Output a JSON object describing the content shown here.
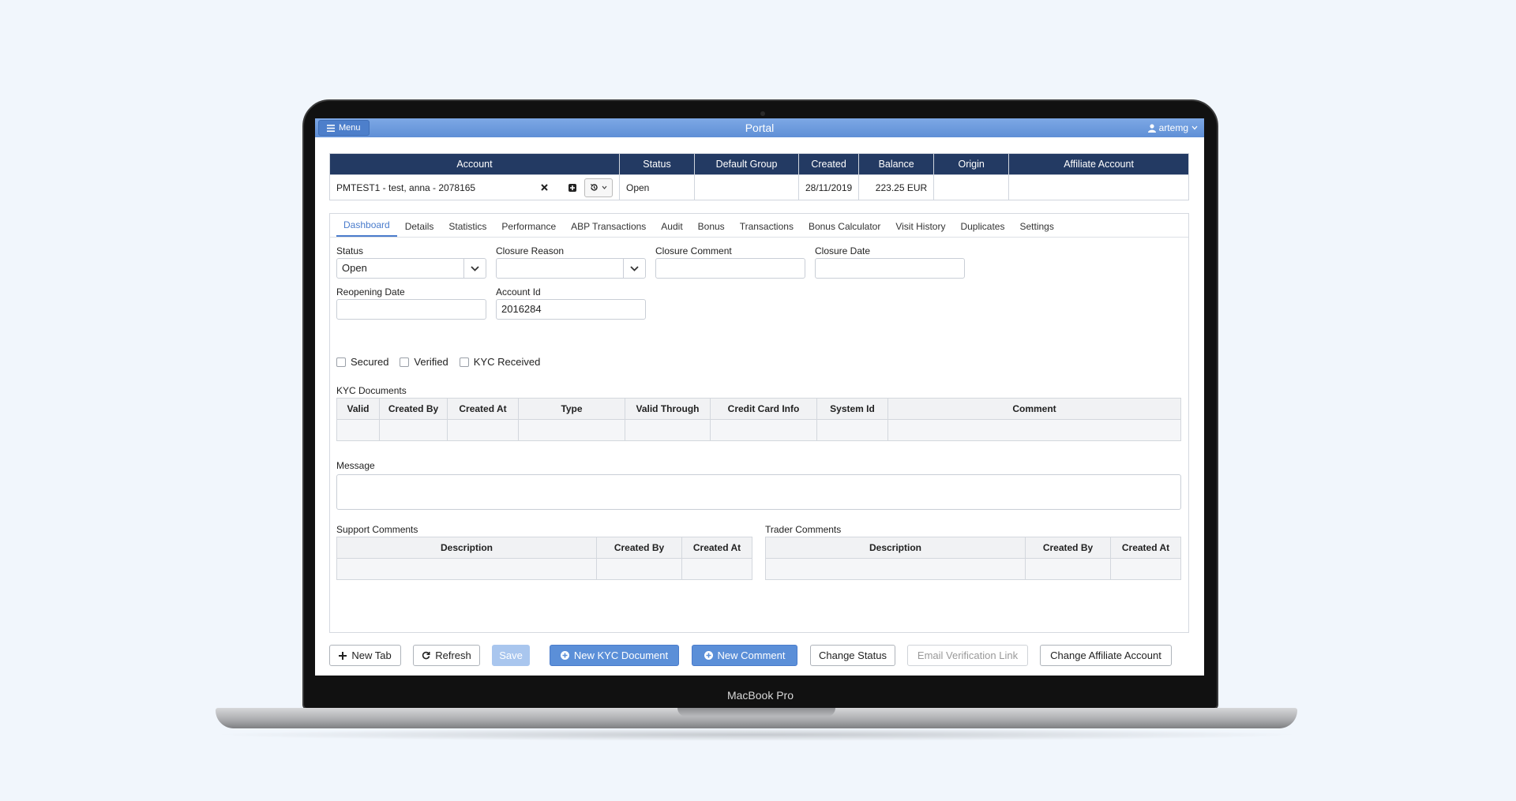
{
  "laptop": {
    "brand": "MacBook Pro"
  },
  "topbar": {
    "menu_label": "Menu",
    "title": "Portal",
    "user": "artemg"
  },
  "account_table": {
    "headers": [
      "Account",
      "Status",
      "Default Group",
      "Created",
      "Balance",
      "Origin",
      "Affiliate Account"
    ],
    "row": {
      "account": "PMTEST1 - test, anna - 2078165",
      "status": "Open",
      "default_group": "",
      "created": "28/11/2019",
      "balance": "223.25 EUR",
      "origin": "",
      "affiliate_account": ""
    }
  },
  "tabs": [
    "Dashboard",
    "Details",
    "Statistics",
    "Performance",
    "ABP Transactions",
    "Audit",
    "Bonus",
    "Transactions",
    "Bonus Calculator",
    "Visit History",
    "Duplicates",
    "Settings"
  ],
  "active_tab": "Dashboard",
  "form": {
    "status_label": "Status",
    "status_value": "Open",
    "closure_reason_label": "Closure Reason",
    "closure_reason_value": "",
    "closure_comment_label": "Closure Comment",
    "closure_comment_value": "",
    "closure_date_label": "Closure Date",
    "closure_date_value": "",
    "reopening_date_label": "Reopening Date",
    "reopening_date_value": "",
    "account_id_label": "Account Id",
    "account_id_value": "2016284"
  },
  "checkboxes": [
    {
      "label": "Secured",
      "checked": false
    },
    {
      "label": "Verified",
      "checked": false
    },
    {
      "label": "KYC Received",
      "checked": false
    }
  ],
  "kyc": {
    "title": "KYC Documents",
    "headers": [
      "Valid",
      "Created By",
      "Created At",
      "Type",
      "Valid Through",
      "Credit Card Info",
      "System Id",
      "Comment"
    ]
  },
  "message": {
    "label": "Message",
    "value": ""
  },
  "support_comments": {
    "title": "Support Comments",
    "headers": [
      "Description",
      "Created By",
      "Created At"
    ]
  },
  "trader_comments": {
    "title": "Trader Comments",
    "headers": [
      "Description",
      "Created By",
      "Created At"
    ]
  },
  "buttons": {
    "new_tab": "New Tab",
    "refresh": "Refresh",
    "save": "Save",
    "new_kyc": "New KYC Document",
    "new_comment": "New Comment",
    "change_status": "Change Status",
    "email_verification": "Email Verification Link",
    "change_affiliate": "Change Affiliate Account"
  },
  "colors": {
    "header_bar": "#5f8fd6",
    "table_header": "#233a63",
    "accent": "#4a7ccc",
    "background": "#f1f6fc"
  },
  "icons": [
    "menu-icon",
    "user-icon",
    "clear-icon",
    "add-icon",
    "history-icon",
    "chevron-down-icon",
    "plus-icon",
    "refresh-icon",
    "plus-circle-icon"
  ]
}
